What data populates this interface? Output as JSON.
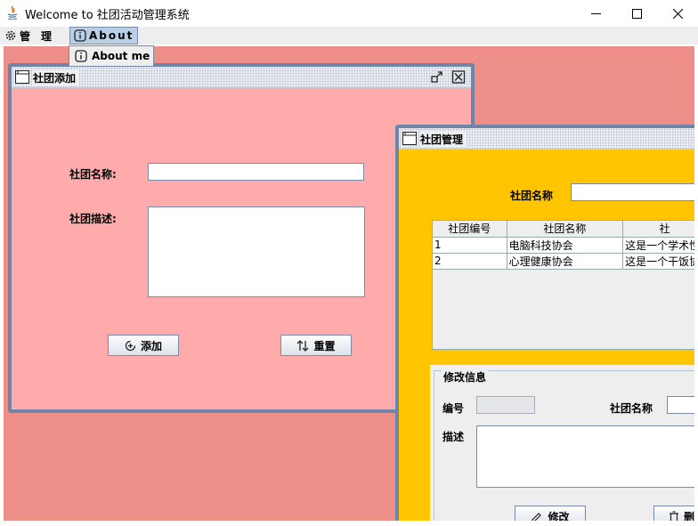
{
  "window": {
    "title": "Welcome to 社团活动管理系统"
  },
  "menubar": {
    "manage_label": "管　理",
    "about_label": "About",
    "dropdown_items": [
      {
        "label": "About me",
        "icon": "info-icon"
      }
    ]
  },
  "add_frame": {
    "title": "社团添加",
    "name_label": "社团名称:",
    "name_value": "",
    "desc_label": "社团描述:",
    "desc_value": "",
    "add_button": "添加",
    "reset_button": "重置"
  },
  "manage_frame": {
    "title": "社团管理",
    "search_label": "社团名称",
    "search_value": "",
    "table": {
      "columns": [
        "社团编号",
        "社团名称",
        "社"
      ],
      "rows": [
        [
          "1",
          "电脑科技协会",
          "这是一个学术性"
        ],
        [
          "2",
          "心理健康协会",
          "这是一个干饭协"
        ]
      ]
    },
    "modify": {
      "legend": "修改信息",
      "id_label": "编号",
      "id_value": "",
      "name_label": "社团名称",
      "name_value": "",
      "desc_label": "描述",
      "desc_value": "",
      "modify_button": "修改",
      "delete_button": "删"
    }
  },
  "colors": {
    "desktop": "#ee8e88",
    "add_frame_bg": "#ffaaab",
    "manage_frame_bg": "#ffc600",
    "frame_border": "#6f84a6"
  }
}
